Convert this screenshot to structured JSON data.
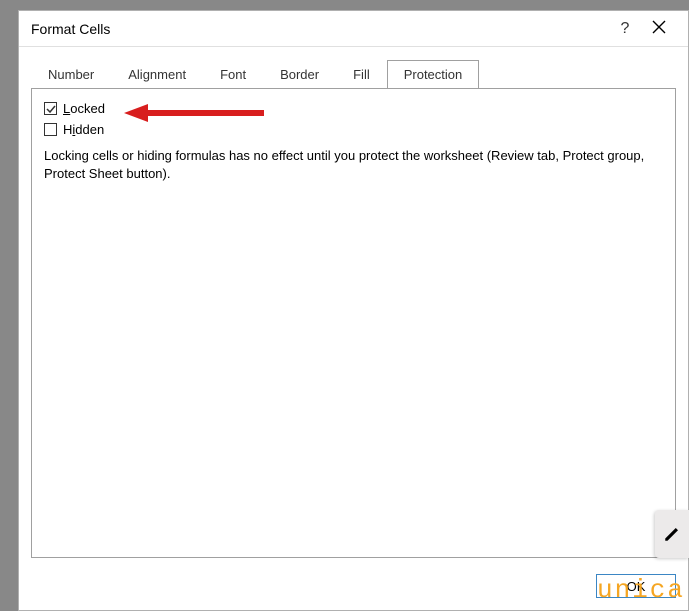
{
  "dialog": {
    "title": "Format Cells",
    "help": "?",
    "tabs": [
      {
        "label": "Number"
      },
      {
        "label": "Alignment"
      },
      {
        "label": "Font"
      },
      {
        "label": "Border"
      },
      {
        "label": "Fill"
      },
      {
        "label": "Protection"
      }
    ],
    "protection": {
      "locked_label": "Locked",
      "locked_checked": true,
      "hidden_label": "Hidden",
      "hidden_checked": false,
      "info": "Locking cells or hiding formulas has no effect until you protect the worksheet (Review tab, Protect group, Protect Sheet button)."
    },
    "buttons": {
      "ok": "OK"
    }
  },
  "watermark": "unica",
  "annotation": {
    "arrow_color": "#d81e1e"
  }
}
